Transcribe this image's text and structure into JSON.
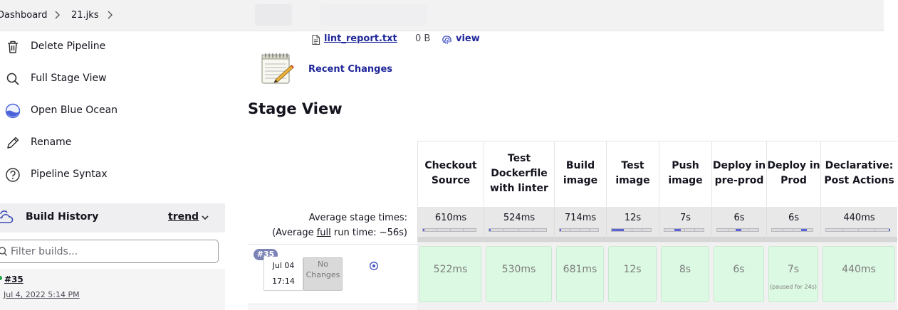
{
  "breadcrumb": {
    "items": [
      "Dashboard",
      "21.jks"
    ]
  },
  "sidebar": {
    "items": [
      {
        "label": "Delete Pipeline",
        "icon": "trash-icon"
      },
      {
        "label": "Full Stage View",
        "icon": "search-icon"
      },
      {
        "label": "Open Blue Ocean",
        "icon": "blue-ocean-icon"
      },
      {
        "label": "Rename",
        "icon": "pencil-icon"
      },
      {
        "label": "Pipeline Syntax",
        "icon": "help-icon"
      }
    ],
    "build_history": {
      "title": "Build History",
      "trend_label": "trend",
      "filter_placeholder": "Filter builds...",
      "builds": [
        {
          "number": "#35",
          "date": "Jul 4, 2022 5:14 PM",
          "status_color": "#1ea446"
        }
      ]
    }
  },
  "artifacts": {
    "file_name": "lint_report.txt",
    "file_size": "0 B",
    "view_label": "view"
  },
  "recent_changes_label": "Recent Changes",
  "stage_view": {
    "title": "Stage View",
    "avg_stage_label": "Average stage times:",
    "avg_run_prefix": "(Average ",
    "avg_run_link": "full",
    "avg_run_suffix": " run time: ~56s)",
    "stages": [
      {
        "name": "Checkout Source",
        "avg": "610ms",
        "avg_fraction": 0.0
      },
      {
        "name": "Test Dockerfile with linter",
        "avg": "524ms",
        "avg_fraction": 0.0
      },
      {
        "name": "Build image",
        "avg": "714ms",
        "avg_fraction": 0.0
      },
      {
        "name": "Test image",
        "avg": "12s",
        "avg_fraction": 0.3
      },
      {
        "name": "Push image",
        "avg": "7s",
        "avg_fraction": 0.16
      },
      {
        "name": "Deploy in pre-prod",
        "avg": "6s",
        "avg_fraction": 0.14
      },
      {
        "name": "Deploy in Prod",
        "avg": "6s",
        "avg_fraction": 0.14
      },
      {
        "name": "Declarative: Post Actions",
        "avg": "440ms",
        "avg_fraction": 0.0
      }
    ],
    "run": {
      "badge": "#35",
      "date": "Jul 04",
      "time": "17:14",
      "changes": "No Changes",
      "cells": [
        "522ms",
        "530ms",
        "681ms",
        "12s",
        "8s",
        "6s",
        "7s",
        "440ms"
      ],
      "notes": [
        "",
        "",
        "",
        "",
        "",
        "",
        "(paused for 24s)",
        ""
      ],
      "success_color": "#dcf9e3"
    }
  }
}
